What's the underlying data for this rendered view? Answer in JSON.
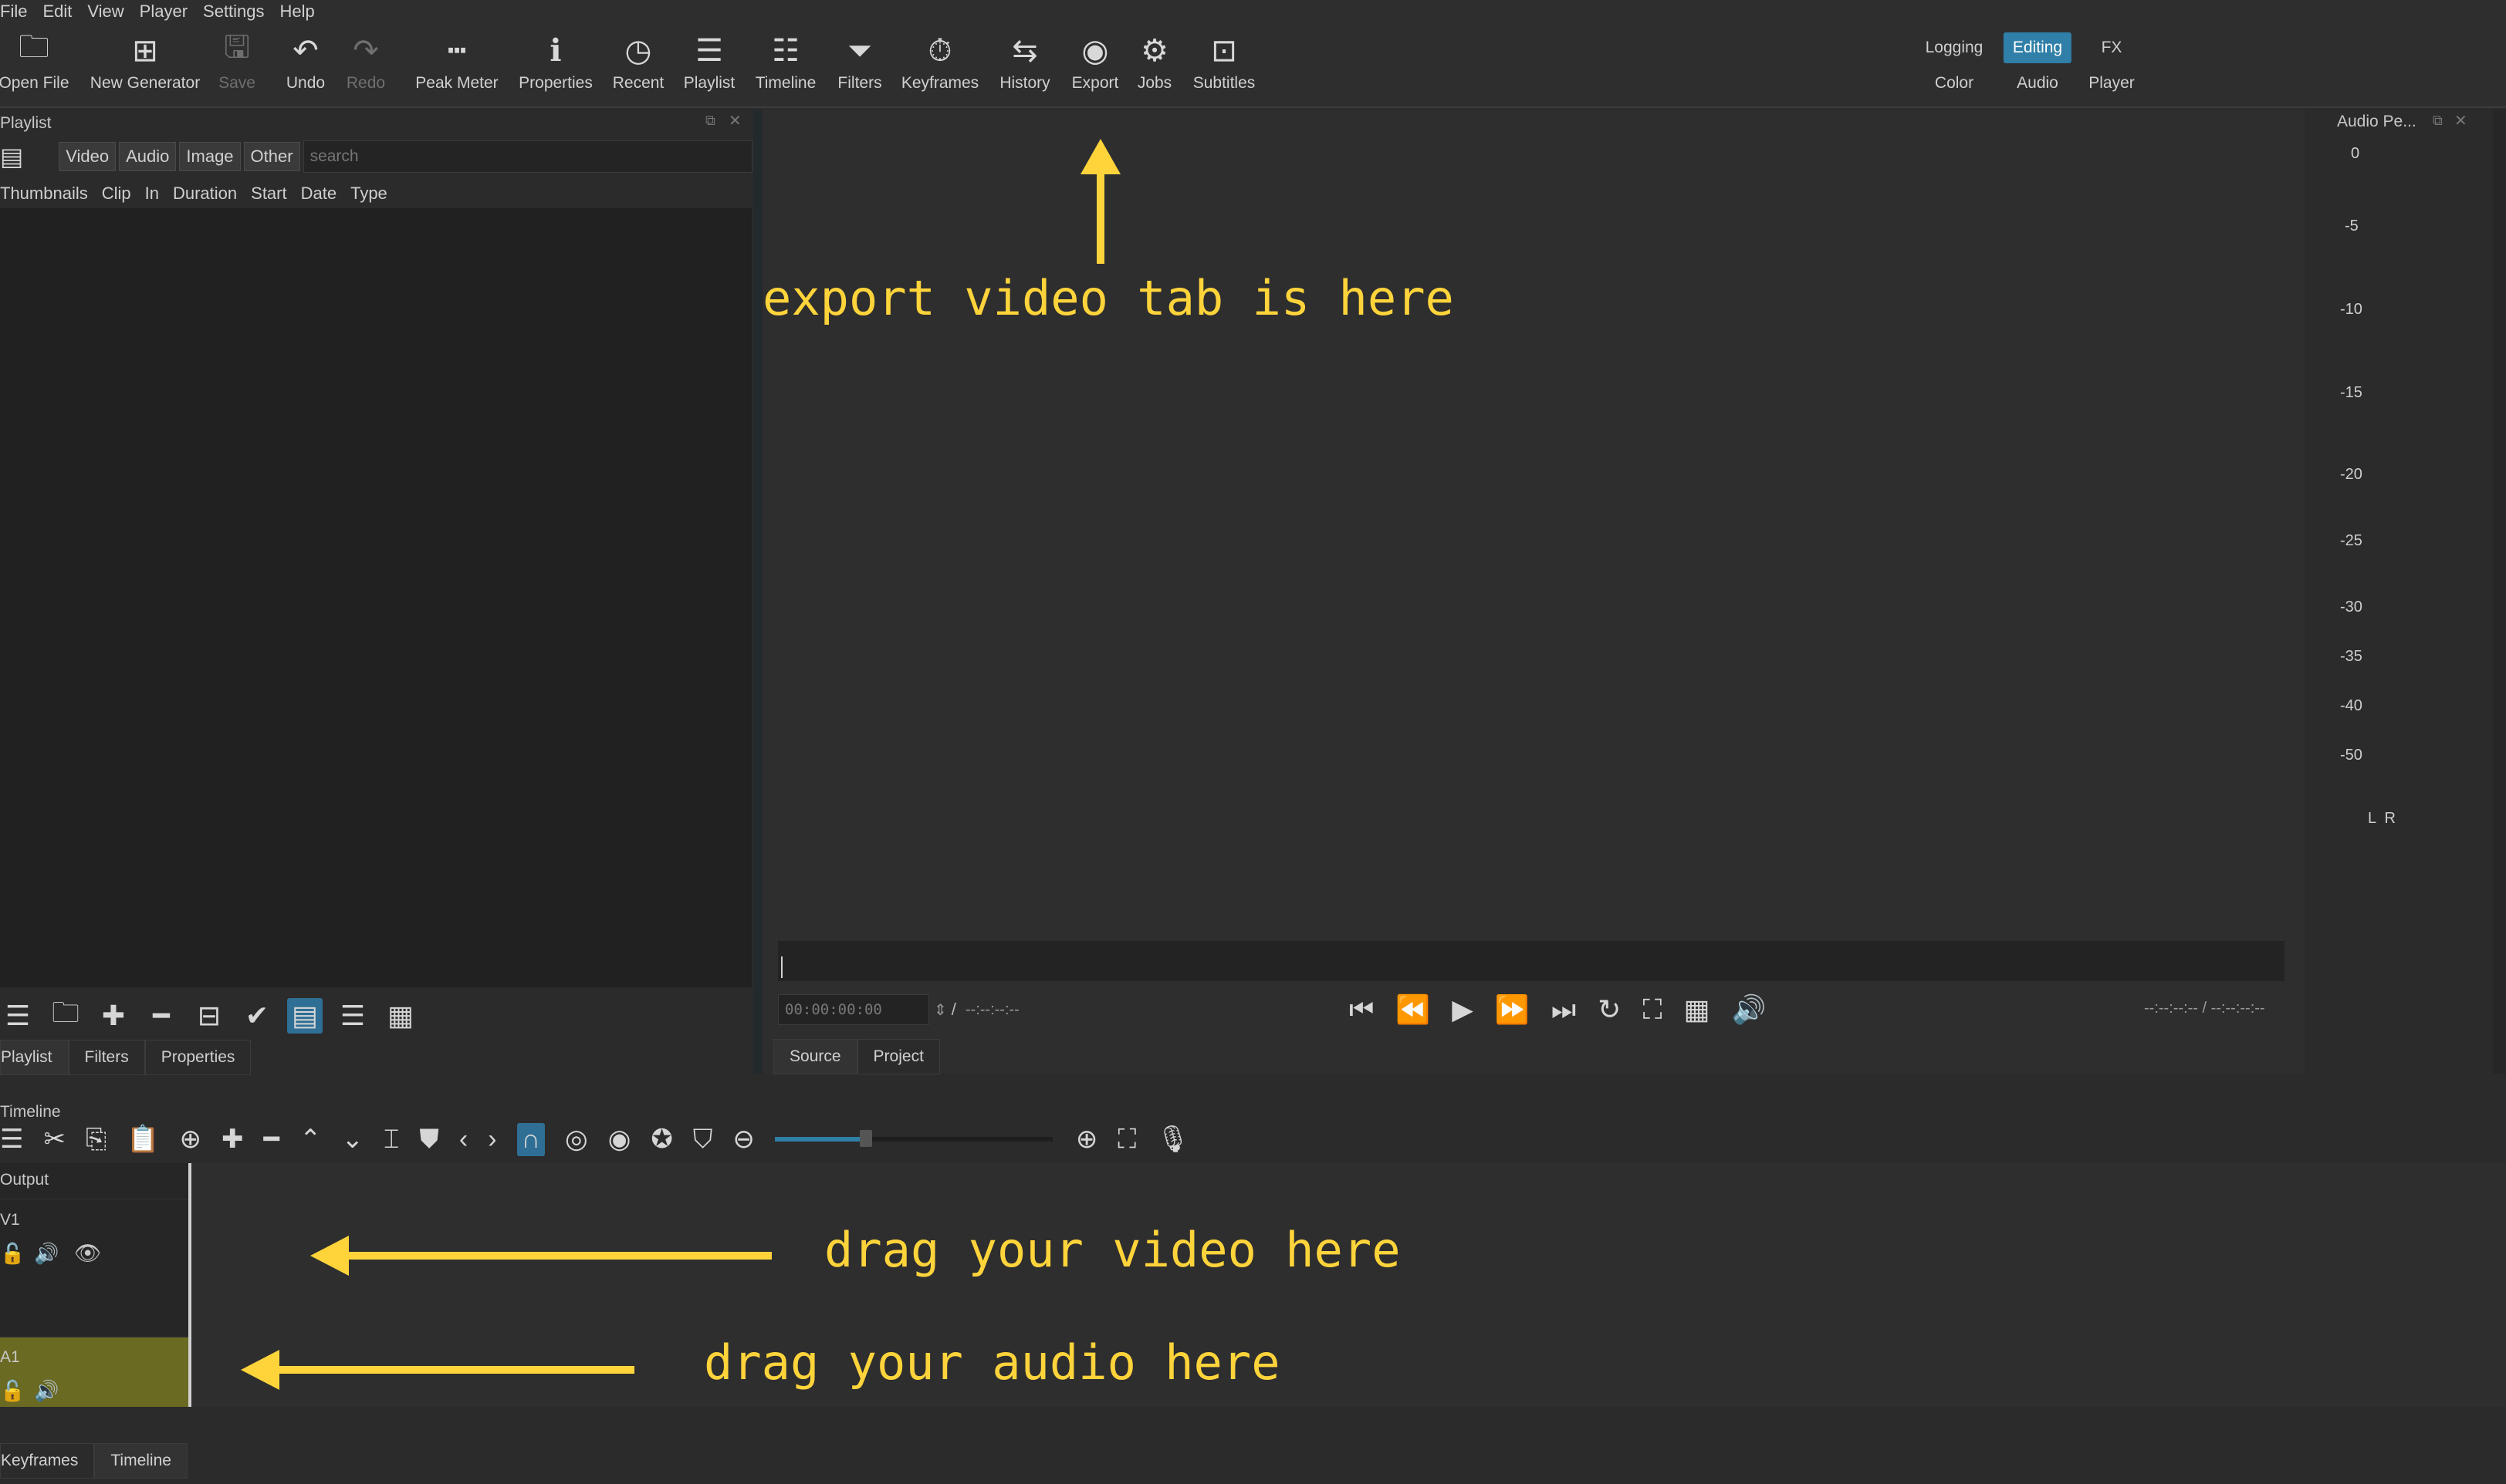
{
  "menu": [
    "File",
    "Edit",
    "View",
    "Player",
    "Settings",
    "Help"
  ],
  "toolbar": {
    "open_file": "Open File",
    "new_generator": "New Generator",
    "save": "Save",
    "undo": "Undo",
    "redo": "Redo",
    "peak_meter": "Peak Meter",
    "properties": "Properties",
    "recent": "Recent",
    "playlist": "Playlist",
    "timeline": "Timeline",
    "filters": "Filters",
    "keyframes": "Keyframes",
    "history": "History",
    "export": "Export",
    "jobs": "Jobs",
    "subtitles": "Subtitles"
  },
  "workspaces": {
    "logging": "Logging",
    "editing": "Editing",
    "fx": "FX",
    "color": "Color",
    "audio": "Audio",
    "player": "Player"
  },
  "playlist": {
    "title": "Playlist",
    "filters": [
      "Video",
      "Audio",
      "Image",
      "Other"
    ],
    "search_placeholder": "search",
    "columns": [
      "Thumbnails",
      "Clip",
      "In",
      "Duration",
      "Start",
      "Date",
      "Type"
    ],
    "tabs": [
      "Playlist",
      "Filters",
      "Properties"
    ]
  },
  "player": {
    "timecode": "00:00:00:00",
    "separator": "/",
    "duration": "--:--:--:--",
    "in_out": "--:--:--:-- / --:--:--:--",
    "tabs": [
      "Source",
      "Project"
    ]
  },
  "meter": {
    "title": "Audio Pe...",
    "ticks": [
      "0",
      "-5",
      "-10",
      "-15",
      "-20",
      "-25",
      "-30",
      "-35",
      "-40",
      "-50"
    ],
    "channels": "L  R"
  },
  "timeline": {
    "title": "Timeline",
    "output_label": "Output",
    "tracks": [
      "V1",
      "A1"
    ],
    "bottom_tabs": [
      "Keyframes",
      "Timeline"
    ]
  },
  "annotations": {
    "export": "export video tab is here",
    "video": "drag your video here",
    "audio": "drag your audio here"
  },
  "colors": {
    "accent": "#2f7fa8",
    "annotation": "#ffd43b",
    "audio_track": "#6b6a23"
  }
}
